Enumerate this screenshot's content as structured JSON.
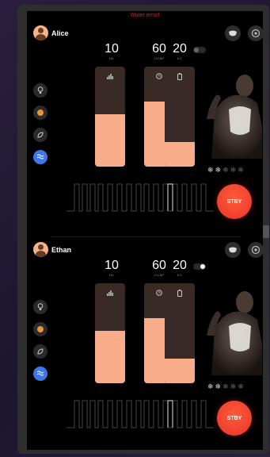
{
  "app": {
    "error_text": "Water error!"
  },
  "panels": [
    {
      "user": {
        "name": "Alice"
      },
      "params": [
        {
          "value": "10",
          "unit": "Hz"
        },
        {
          "value": "60",
          "unit": "J/CM²"
        },
        {
          "value": "20",
          "unit": "KJ"
        }
      ],
      "toggle_on": false,
      "levels": [
        0.52,
        0.65,
        0.25
      ],
      "cooling": {
        "glyph": "❄",
        "total": 5,
        "on": 2
      },
      "standby_label": "STBY"
    },
    {
      "user": {
        "name": "Ethan"
      },
      "params": [
        {
          "value": "10",
          "unit": "Hz"
        },
        {
          "value": "60",
          "unit": "J/CM²"
        },
        {
          "value": "20",
          "unit": "KJ"
        }
      ],
      "toggle_on": true,
      "levels": [
        0.52,
        0.65,
        0.25
      ],
      "cooling": {
        "glyph": "❄",
        "total": 5,
        "on": 2
      },
      "standby_label": "STBY"
    }
  ],
  "colors": {
    "accent_blue": "#3c78e8",
    "bar_fill": "#f8ac8a",
    "bar_track": "#3a2a26",
    "stby": "#e8352a",
    "error": "#d02222"
  },
  "icons": [
    "user-avatar-icon",
    "hair-removal-icon",
    "settings-icon",
    "bulb-icon",
    "orange-dot-icon",
    "leaf-icon",
    "waves-icon",
    "signal-bars-icon",
    "timer-icon",
    "battery-icon",
    "snowflake-icon"
  ]
}
